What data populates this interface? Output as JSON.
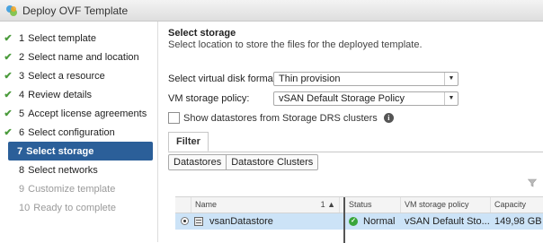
{
  "window": {
    "title": "Deploy OVF Template",
    "icon": "vsphere-logo-icon"
  },
  "steps": [
    {
      "num": "1",
      "label": "Select template",
      "state": "done"
    },
    {
      "num": "2",
      "label": "Select name and location",
      "state": "done"
    },
    {
      "num": "3",
      "label": "Select a resource",
      "state": "done"
    },
    {
      "num": "4",
      "label": "Review details",
      "state": "done"
    },
    {
      "num": "5",
      "label": "Accept license agreements",
      "state": "done"
    },
    {
      "num": "6",
      "label": "Select configuration",
      "state": "done"
    },
    {
      "num": "7",
      "label": "Select storage",
      "state": "active"
    },
    {
      "num": "8",
      "label": "Select networks",
      "state": "pending"
    },
    {
      "num": "9",
      "label": "Customize template",
      "state": "disabled"
    },
    {
      "num": "10",
      "label": "Ready to complete",
      "state": "disabled"
    }
  ],
  "main": {
    "title": "Select storage",
    "description": "Select location to store the files for the deployed template.",
    "disk_format_label": "Select virtual disk format:",
    "disk_format_value": "Thin provision",
    "policy_label": "VM storage policy:",
    "policy_value": "vSAN Default Storage Policy",
    "show_drs_label": "Show datastores from Storage DRS clusters",
    "show_drs_checked": false
  },
  "tabs": {
    "filter": "Filter"
  },
  "segments": {
    "datastores": "Datastores",
    "clusters": "Datastore Clusters"
  },
  "grid": {
    "headers": {
      "name": "Name",
      "sort": "1 ▲",
      "status": "Status",
      "policy": "VM storage policy",
      "capacity": "Capacity"
    },
    "rows": [
      {
        "name": "vsanDatastore",
        "status": "Normal",
        "policy": "vSAN Default Sto...",
        "capacity": "149,98  GB",
        "selected": true
      }
    ]
  },
  "colors": {
    "accent": "#2b5f99",
    "check": "#4b9b3c",
    "selected_row": "#cce3f7",
    "status_ok": "#3aa53a"
  }
}
